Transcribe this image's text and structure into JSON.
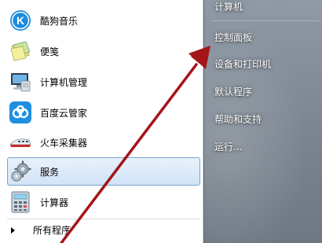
{
  "start_menu": {
    "programs": [
      {
        "label": "酷狗音乐",
        "icon": "kugou-music-icon"
      },
      {
        "label": "便笺",
        "icon": "sticky-notes-icon"
      },
      {
        "label": "计算机管理",
        "icon": "computer-management-icon"
      },
      {
        "label": "百度云管家",
        "icon": "baidu-cloud-icon"
      },
      {
        "label": "火车采集器",
        "icon": "train-collector-icon"
      },
      {
        "label": "服务",
        "icon": "services-gear-icon",
        "highlighted": true
      },
      {
        "label": "计算器",
        "icon": "calculator-icon"
      }
    ],
    "all_programs_label": "所有程序",
    "right_items": [
      {
        "label": "计算机"
      },
      {
        "label": "控制面板"
      },
      {
        "label": "设备和打印机"
      },
      {
        "label": "默认程序"
      },
      {
        "label": "帮助和支持"
      },
      {
        "label": "运行..."
      }
    ]
  },
  "colors": {
    "highlight_border": "#7da2ce",
    "highlight_fill": "#d1e3f7",
    "annotation_arrow": "#a31518",
    "right_pane": "#7b8591"
  }
}
